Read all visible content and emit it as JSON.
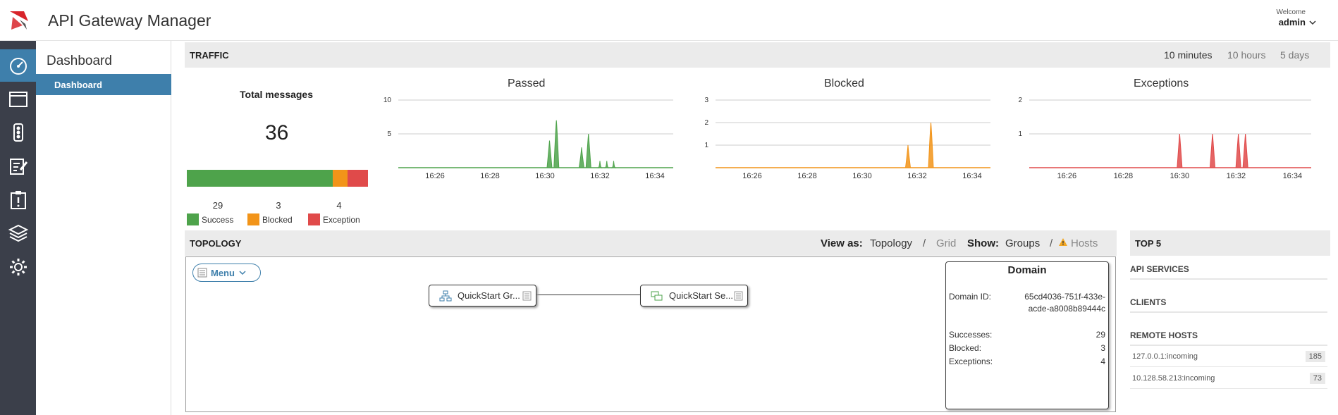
{
  "header": {
    "title": "API Gateway Manager",
    "welcome_label": "Welcome",
    "user": "admin"
  },
  "icon_bar": [
    "dashboard-icon",
    "window-icon",
    "traffic-light-icon",
    "edit-icon",
    "alert-clipboard-icon",
    "layers-icon",
    "settings-icon"
  ],
  "nav": {
    "title": "Dashboard",
    "active_item": "Dashboard"
  },
  "traffic": {
    "title": "TRAFFIC",
    "ranges": [
      "10 minutes",
      "10 hours",
      "5 days"
    ],
    "selected_range": "10 minutes",
    "total_title": "Total messages",
    "total": "36",
    "success_count": "29",
    "blocked_count": "3",
    "exception_count": "4",
    "success_label": "Success",
    "blocked_label": "Blocked",
    "exception_label": "Exception",
    "colors": {
      "success": "#4ea34b",
      "blocked": "#f29419",
      "exception": "#e04a4a"
    }
  },
  "chart_data": [
    {
      "type": "area",
      "title": "Passed",
      "color": "#4ea34b",
      "ylim": [
        0,
        10
      ],
      "yticks": [
        "5",
        "10"
      ],
      "xticks": [
        "16:26",
        "16:28",
        "16:30",
        "16:32",
        "16:34"
      ],
      "x": [
        "16:30:10",
        "16:30:25",
        "16:31:20",
        "16:31:35",
        "16:32:00",
        "16:32:15",
        "16:32:30"
      ],
      "values": [
        4,
        7,
        3,
        5,
        1,
        1,
        1
      ]
    },
    {
      "type": "area",
      "title": "Blocked",
      "color": "#f29419",
      "ylim": [
        0,
        3
      ],
      "yticks": [
        "1",
        "2",
        "3"
      ],
      "xticks": [
        "16:26",
        "16:28",
        "16:30",
        "16:32",
        "16:34"
      ],
      "x": [
        "16:31:40",
        "16:32:30"
      ],
      "values": [
        1,
        2
      ]
    },
    {
      "type": "area",
      "title": "Exceptions",
      "color": "#e04a4a",
      "ylim": [
        0,
        2
      ],
      "yticks": [
        "1",
        "2"
      ],
      "xticks": [
        "16:26",
        "16:28",
        "16:30",
        "16:32",
        "16:34"
      ],
      "x": [
        "16:30:00",
        "16:31:10",
        "16:32:05",
        "16:32:20"
      ],
      "values": [
        1,
        1,
        1,
        1
      ]
    }
  ],
  "topology": {
    "title": "TOPOLOGY",
    "view_as_label": "View as:",
    "view_topology": "Topology",
    "view_grid": "Grid",
    "show_label": "Show:",
    "show_groups": "Groups",
    "show_hosts": "Hosts",
    "separator": "/",
    "menu_label": "Menu",
    "node_group": "QuickStart Gr...",
    "node_server": "QuickStart Se..."
  },
  "domain": {
    "title": "Domain",
    "id_label": "Domain ID:",
    "id_line1": "65cd4036-751f-433e-",
    "id_line2": "acde-a8008b89444c",
    "successes_label": "Successes:",
    "successes": "29",
    "blocked_label": "Blocked:",
    "blocked": "3",
    "exceptions_label": "Exceptions:",
    "exceptions": "4"
  },
  "top5": {
    "title": "TOP 5",
    "api_services": "API SERVICES",
    "clients": "CLIENTS",
    "remote_hosts": "REMOTE HOSTS",
    "hosts": [
      {
        "name": "127.0.0.1:incoming",
        "count": "185"
      },
      {
        "name": "10.128.58.213:incoming",
        "count": "73"
      }
    ]
  }
}
